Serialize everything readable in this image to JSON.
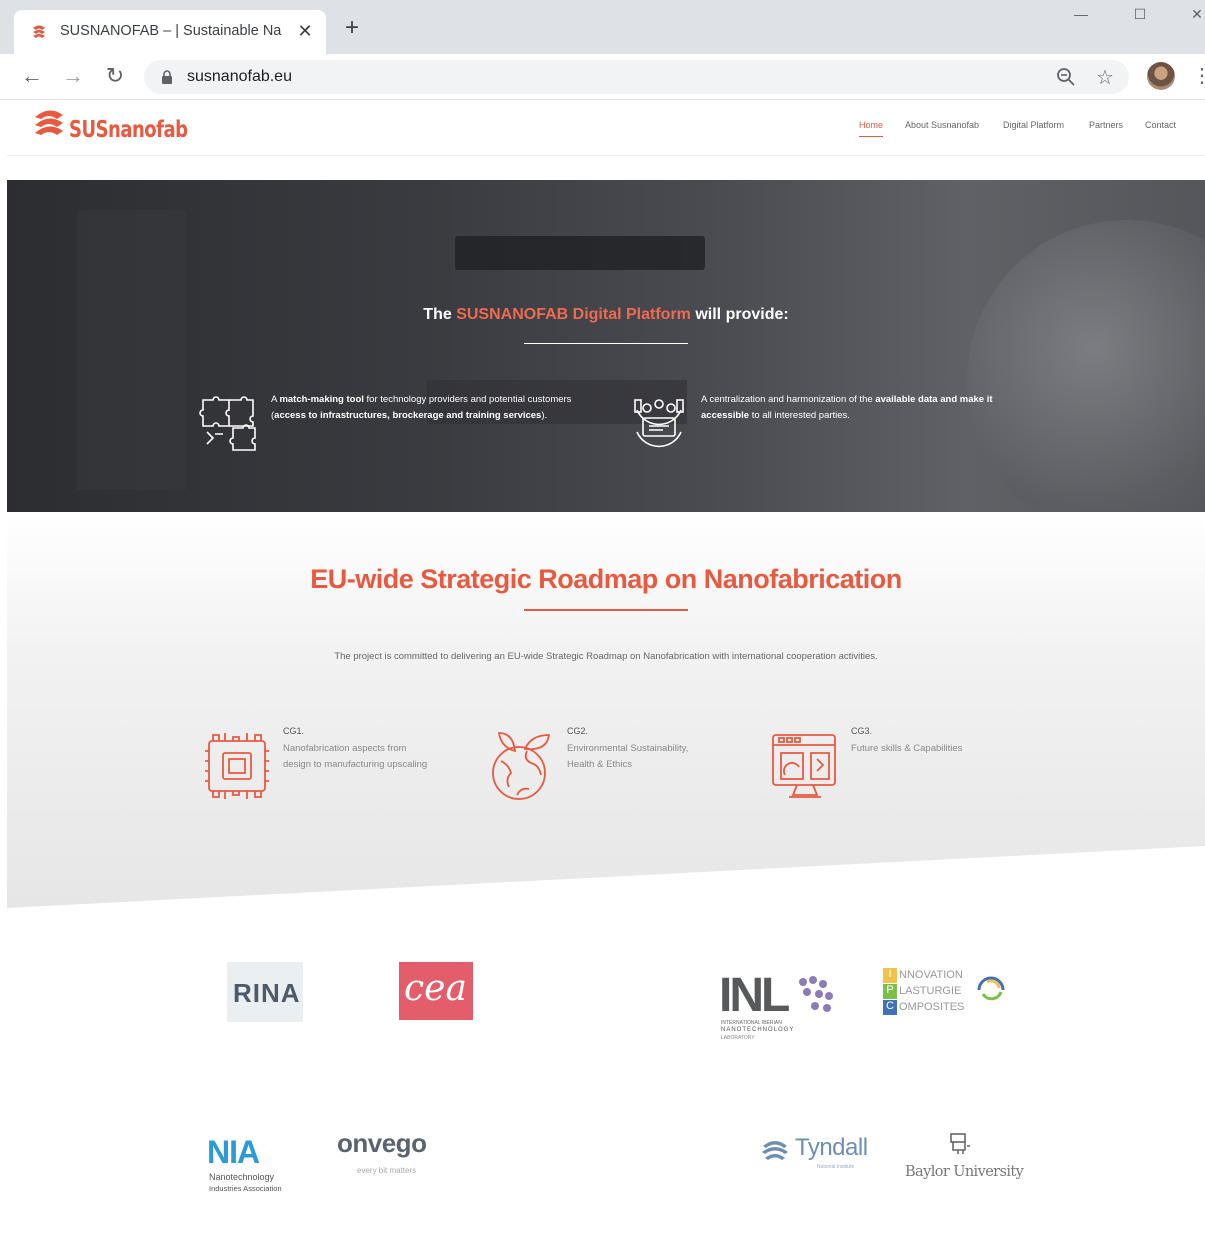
{
  "browser": {
    "tab_title": "SUSNANOFAB – | Sustainable Na",
    "tab_close": "✕",
    "new_tab": "+",
    "url": "susnanofab.eu",
    "window_controls": {
      "minimize": "—",
      "maximize": "☐",
      "close": "✕"
    },
    "icons": [
      "back-arrow-icon",
      "forward-arrow-icon",
      "reload-icon",
      "lock-icon",
      "zoom-icon",
      "star-icon",
      "profile-avatar",
      "menu-dots-icon"
    ]
  },
  "site": {
    "logo_text": "SUSnanofab",
    "nav": [
      "Home",
      "About Susnanofab",
      "Digital Platform",
      "Partners",
      "Contact"
    ],
    "nav_active": "Home",
    "accent_color": "#e85a40"
  },
  "hero": {
    "title_pre": "The",
    "title_accent": "SUSNANOFAB Digital Platform",
    "title_post": "will provide:",
    "feature1": {
      "t1": "A ",
      "b1": "match-making tool",
      "t2": " for technology providers and potential customers (",
      "b2": "access to infrastructures, brockerage and training services",
      "t3": ")."
    },
    "feature2": {
      "t1": "A centralization and harmonization of the ",
      "b1": "available data and make it accessible",
      "t2": " to all interested parties."
    }
  },
  "roadmap": {
    "title": "EU-wide Strategic Roadmap on Nanofabrication",
    "description": "The project is committed to delivering an EU-wide Strategic Roadmap on Nanofabrication with international cooperation activities.",
    "groups": [
      {
        "code": "CG1.",
        "desc": "Nanofabrication aspects from design to manufacturing upscaling",
        "icon": "chip-icon"
      },
      {
        "code": "CG2.",
        "desc": "Environmental Sustainability, Health & Ethics",
        "icon": "globe-leaf-icon"
      },
      {
        "code": "CG3.",
        "desc": "Future skills & Capabilities",
        "icon": "computer-screen-icon"
      }
    ]
  },
  "partners": {
    "rina": "RINA",
    "cea": "cea",
    "inl": "INL",
    "inl_sub1": "INTERNATIONAL IBERIAN",
    "inl_sub2": "NANOTECHNOLOGY",
    "inl_sub3": "LABORATORY",
    "ipc_1": "NNOVATION",
    "ipc_2": "LASTURGIE",
    "ipc_3": "OMPOSITES",
    "ipc_l1": "I",
    "ipc_l2": "P",
    "ipc_l3": "C",
    "nia": "NIA",
    "nia_sub1": "Nanotechnology",
    "nia_sub2": "Industries Association",
    "onvego": "onvego",
    "onvego_sub": "every bit matters",
    "tyndall": "Tyndall",
    "tyndall_sub": "National Institute",
    "baylor": "Baylor University"
  }
}
